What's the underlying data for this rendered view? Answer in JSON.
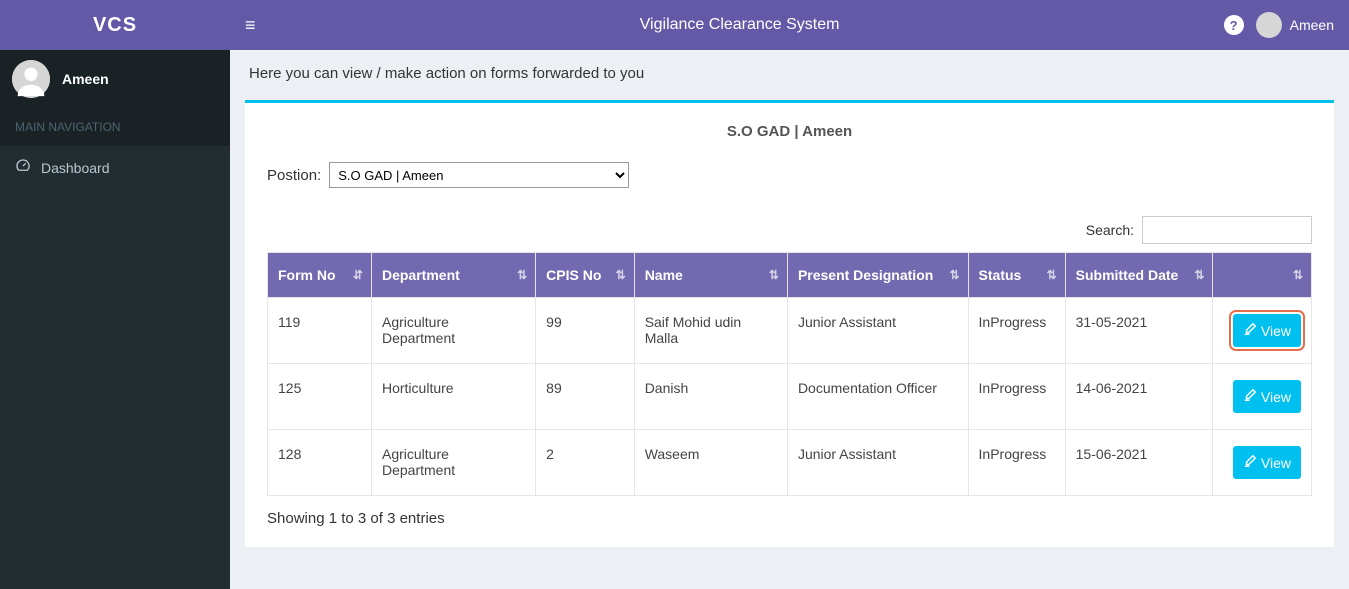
{
  "brand": "VCS",
  "topbar": {
    "title": "Vigilance Clearance System",
    "user": "Ameen"
  },
  "sidebar": {
    "user": "Ameen",
    "nav_header": "MAIN NAVIGATION",
    "dashboard_label": "Dashboard"
  },
  "page": {
    "description": "Here you can view / make action on forms forwarded to you",
    "card_title": "S.O GAD | Ameen",
    "position_label": "Postion:",
    "position_selected": "S.O GAD | Ameen",
    "search_label": "Search:",
    "table_info": "Showing 1 to 3 of 3 entries"
  },
  "table": {
    "headers": {
      "form_no": "Form No",
      "department": "Department",
      "cpis_no": "CPIS No",
      "name": "Name",
      "designation": "Present Designation",
      "status": "Status",
      "submitted_date": "Submitted Date",
      "actions": ""
    },
    "rows": [
      {
        "form_no": "119",
        "department": "Agriculture Department",
        "cpis_no": "99",
        "name": "Saif Mohid udin Malla",
        "designation": "Junior Assistant",
        "status": "InProgress",
        "submitted_date": "31-05-2021",
        "view_label": "View"
      },
      {
        "form_no": "125",
        "department": "Horticulture",
        "cpis_no": "89",
        "name": "Danish",
        "designation": "Documentation Officer",
        "status": "InProgress",
        "submitted_date": "14-06-2021",
        "view_label": "View"
      },
      {
        "form_no": "128",
        "department": "Agriculture Department",
        "cpis_no": "2",
        "name": "Waseem",
        "designation": "Junior Assistant",
        "status": "InProgress",
        "submitted_date": "15-06-2021",
        "view_label": "View"
      }
    ]
  }
}
